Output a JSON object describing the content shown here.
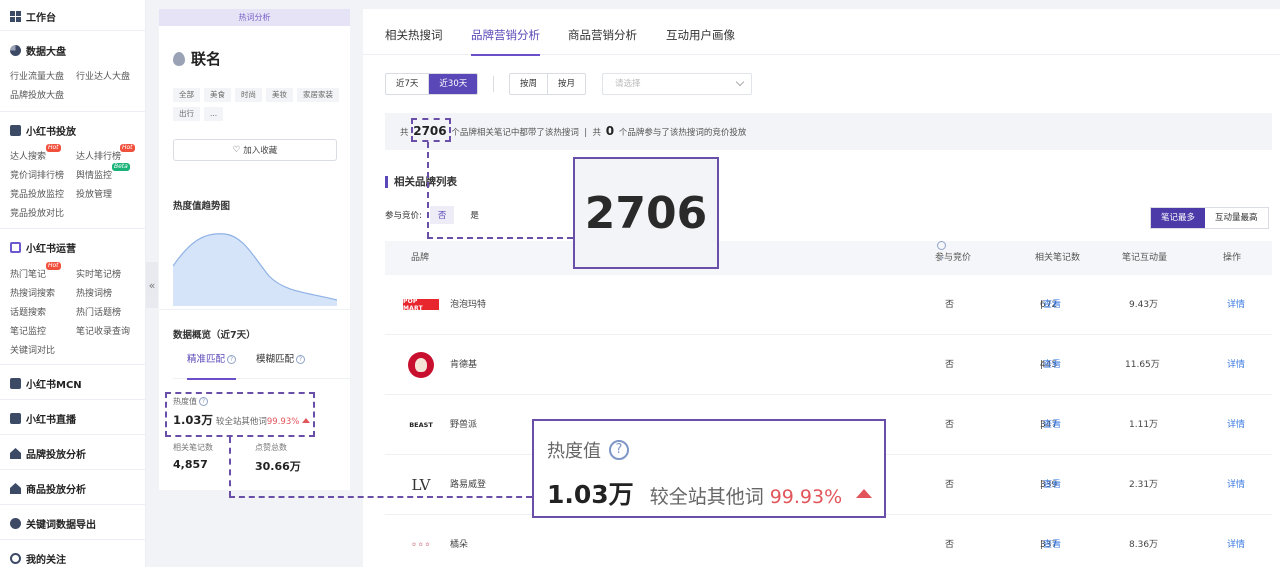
{
  "nav": {
    "workbench": "工作台",
    "sections": [
      {
        "title": "数据大盘",
        "items": [
          "行业流量大盘",
          "行业达人大盘",
          "品牌投放大盘"
        ]
      },
      {
        "title": "小红书投放",
        "items": [
          "达人搜索",
          "达人排行榜",
          "竞价词排行榜",
          "舆情监控",
          "竞品投放监控",
          "投放管理",
          "竞品投放对比"
        ]
      },
      {
        "title": "小红书运营",
        "items": [
          "热门笔记",
          "实时笔记榜",
          "热搜词搜索",
          "热搜词榜",
          "话题搜索",
          "热门话题榜",
          "笔记监控",
          "笔记收录查询",
          "关键词对比"
        ]
      },
      {
        "title": "小红书MCN"
      },
      {
        "title": "小红书直播"
      },
      {
        "title": "品牌投放分析"
      },
      {
        "title": "商品投放分析"
      },
      {
        "title": "关键词数据导出"
      },
      {
        "title": "我的关注"
      }
    ],
    "badges": {
      "hot": "Hot",
      "beta": "Beta"
    },
    "collapse": "«"
  },
  "keyword_card": {
    "header": "热词分析",
    "keyword": "联名",
    "chips": [
      "全部",
      "美食",
      "时尚",
      "美妆",
      "家居家装",
      "出行",
      "..."
    ],
    "favorite_button": "加入收藏",
    "trend_title": "热度值趋势图",
    "overview_title": "数据概览（近7天）",
    "match_tabs": [
      "精准匹配",
      "模糊匹配"
    ],
    "heat_label": "热度值",
    "heat_value": "1.03万",
    "heat_compare": "较全站其他词",
    "heat_pct": "99.93%",
    "notes_label": "相关笔记数",
    "notes_value": "4,857",
    "likes_label": "点赞总数",
    "likes_value": "30.66万"
  },
  "main": {
    "tabs": [
      "相关热搜词",
      "品牌营销分析",
      "商品营销分析",
      "互动用户画像"
    ],
    "active_tab": 1,
    "range": [
      "近7天",
      "近30天"
    ],
    "granularity": [
      "按周",
      "按月"
    ],
    "select_placeholder": "请选择",
    "info": {
      "prefix": "共",
      "brand_count": "2706",
      "middle": "个品牌相关笔记中都带了该热搜词",
      "sep": "|",
      "prefix2": "共",
      "bid_count": "0",
      "suffix": "个品牌参与了该热搜词的竞价投放"
    },
    "section_title": "相关品牌列表",
    "bid_filter_label": "参与竞价:",
    "bid_options": [
      "否",
      "是"
    ],
    "sort_options": [
      "笔记最多",
      "互动量最高"
    ],
    "table_headers": [
      "品牌",
      "参与竞价",
      "相关笔记数",
      "笔记互动量",
      "操作"
    ],
    "view_link": "查看",
    "detail_link": "详情",
    "rows": [
      {
        "brand": "泡泡玛特",
        "bid": "否",
        "notes": "672",
        "interactions": "9.43万",
        "logo": "POP MART"
      },
      {
        "brand": "肯德基",
        "bid": "否",
        "notes": "445",
        "interactions": "11.65万",
        "logo": ""
      },
      {
        "brand": "野兽派",
        "bid": "否",
        "notes": "347",
        "interactions": "1.11万",
        "logo": "BEAST"
      },
      {
        "brand": "路易威登",
        "bid": "否",
        "notes": "339",
        "interactions": "2.31万",
        "logo": "LV"
      },
      {
        "brand": "橘朵",
        "bid": "否",
        "notes": "337",
        "interactions": "8.36万",
        "logo": ""
      }
    ]
  },
  "callouts": {
    "brand_count": "2706",
    "heat_label": "热度值",
    "heat_value": "1.03万",
    "heat_compare": "较全站其他词",
    "heat_pct": "99.93%"
  },
  "colors": {
    "accent": "#5a48b8",
    "callout": "#6a4fa8",
    "up": "#e2555b",
    "link": "#3d7be0"
  }
}
